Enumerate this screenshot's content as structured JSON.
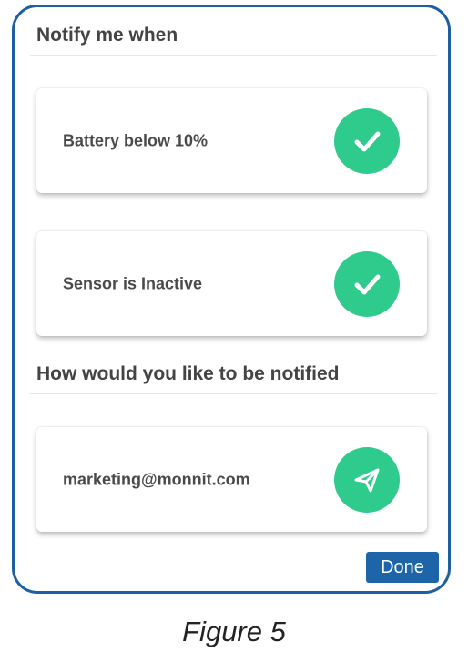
{
  "notify_section": {
    "title": "Notify me when"
  },
  "conditions": [
    {
      "label": "Battery below 10%",
      "icon": "checkmark-icon",
      "checked": true
    },
    {
      "label": "Sensor is Inactive",
      "icon": "checkmark-icon",
      "checked": true
    }
  ],
  "method_section": {
    "title": "How would you like to be notified"
  },
  "methods": [
    {
      "label": "marketing@monnit.com",
      "icon": "send-icon"
    }
  ],
  "done_label": "Done",
  "caption": "Figure 5",
  "colors": {
    "accent_green": "#2fcb8c",
    "frame_blue": "#1d5fa3",
    "button_blue": "#1d64a8"
  }
}
